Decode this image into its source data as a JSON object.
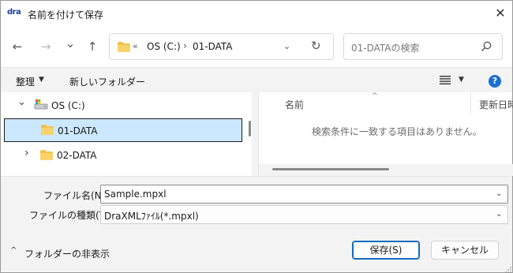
{
  "window": {
    "title": "名前を付けて保存",
    "app_logo_text": "dra",
    "close_glyph": "✕"
  },
  "nav": {
    "back_glyph": "←",
    "forward_glyph": "→",
    "recent_glyph": "⌄",
    "up_glyph": "↑",
    "address": {
      "overflow": "«",
      "drive": "OS (C:)",
      "separator": "›",
      "folder": "01-DATA",
      "dropdown_glyph": "⌄",
      "refresh_glyph": "↻"
    },
    "search": {
      "placeholder": "01-DATAの検索"
    }
  },
  "command_bar": {
    "organize_label": "整理",
    "organize_caret": "▼",
    "new_folder_label": "新しいフォルダー",
    "view_caret": "▼",
    "help_glyph": "?"
  },
  "tree": {
    "items": [
      {
        "label": "OS (C:)",
        "chevron": "⌄",
        "icon": "drive-icon",
        "state": "expanded"
      },
      {
        "label": "01-DATA",
        "icon": "folder-icon",
        "state": "selected"
      },
      {
        "label": "02-DATA",
        "chevron": "›",
        "icon": "folder-icon",
        "state": "collapsed"
      }
    ]
  },
  "file_list": {
    "columns": [
      "名前",
      "更新日時"
    ],
    "sort_glyph": "^",
    "empty_message": "検索条件に一致する項目はありません。"
  },
  "form": {
    "filename_label": "ファイル名(N):",
    "filename_value": "Sample.mpxl",
    "filetype_label": "ファイルの種類(T):",
    "filetype_value": "DraXMLﾌｧｲﾙ(*.mpxl)",
    "dropdown_glyph": "⌄",
    "hide_folders_caret": "^",
    "hide_folders_label": "フォルダーの非表示",
    "save_label": "保存(S)",
    "cancel_label": "キャンセル"
  },
  "colors": {
    "accent": "#0f6cbd",
    "selection": "#cce8ff",
    "help": "#1a6fd1",
    "folder": "#f2c14e"
  }
}
